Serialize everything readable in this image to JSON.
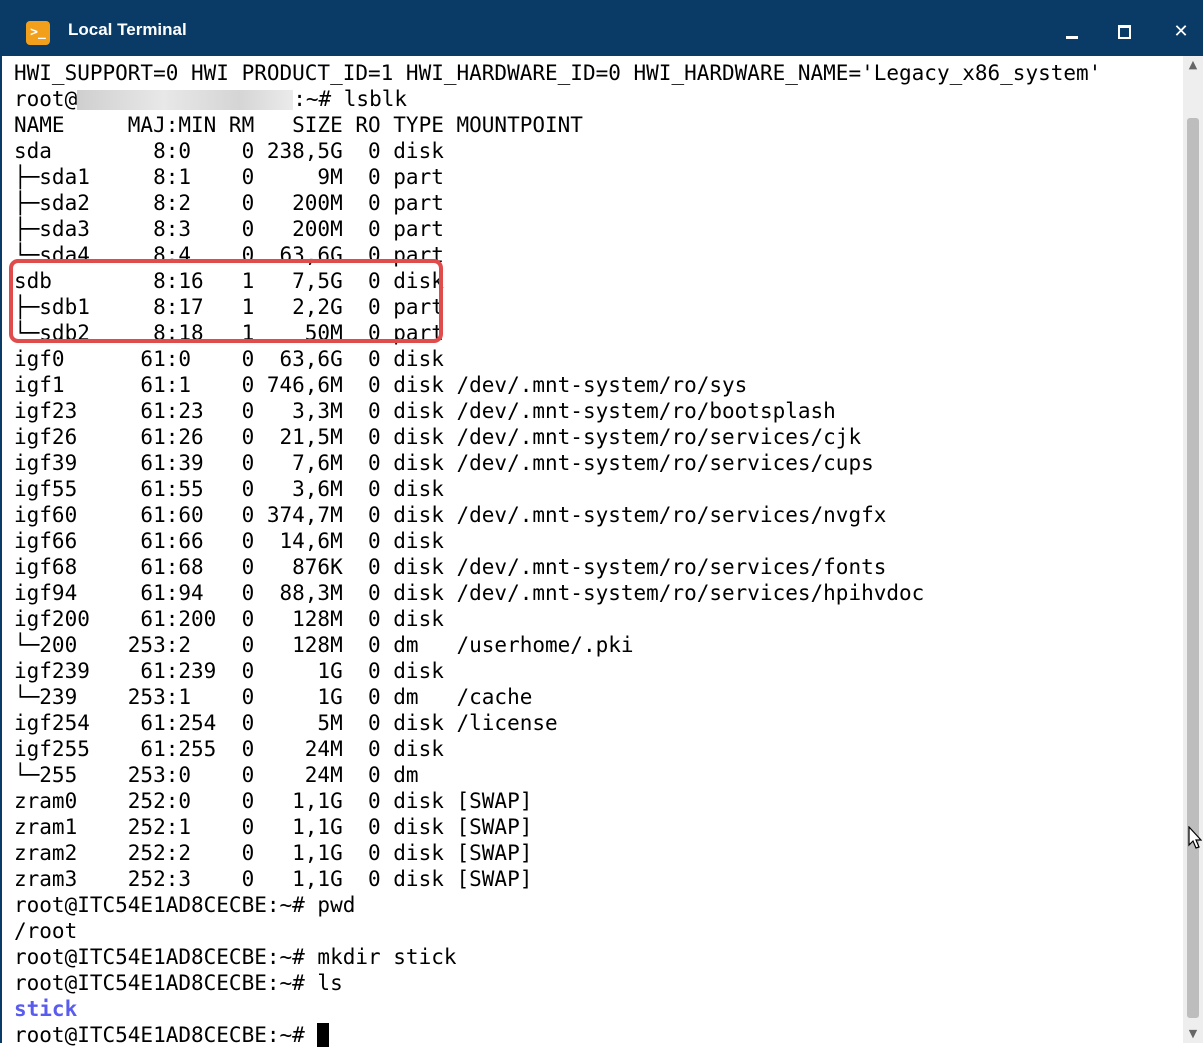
{
  "window": {
    "title": "Local Terminal",
    "icon": "terminal-app-icon",
    "icon_glyph": ">_",
    "controls": {
      "minimize": "minimize-icon",
      "maximize": "maximize-icon",
      "close": "close-icon",
      "close_glyph": "✕"
    }
  },
  "colors": {
    "titlebar": "#0a3b67",
    "highlight_box": "#e04b4b",
    "directory_text": "#5a5cf0"
  },
  "terminal": {
    "lines": [
      "HWI_SUPPORT=0 HWI PRODUCT_ID=1 HWI_HARDWARE_ID=0 HWI_HARDWARE_NAME='Legacy_x86_system'",
      {
        "before": "root@",
        "after": ":~# lsblk"
      },
      "NAME     MAJ:MIN RM   SIZE RO TYPE MOUNTPOINT",
      "sda        8:0    0 238,5G  0 disk",
      "├─sda1     8:1    0     9M  0 part",
      "├─sda2     8:2    0   200M  0 part",
      "├─sda3     8:3    0   200M  0 part",
      "└─sda4     8:4    0  63,6G  0 part",
      "sdb        8:16   1   7,5G  0 disk",
      "├─sdb1     8:17   1   2,2G  0 part",
      "└─sdb2     8:18   1    50M  0 part",
      "igf0      61:0    0  63,6G  0 disk",
      "igf1      61:1    0 746,6M  0 disk /dev/.mnt-system/ro/sys",
      "igf23     61:23   0   3,3M  0 disk /dev/.mnt-system/ro/bootsplash",
      "igf26     61:26   0  21,5M  0 disk /dev/.mnt-system/ro/services/cjk",
      "igf39     61:39   0   7,6M  0 disk /dev/.mnt-system/ro/services/cups",
      "igf55     61:55   0   3,6M  0 disk",
      "igf60     61:60   0 374,7M  0 disk /dev/.mnt-system/ro/services/nvgfx",
      "igf66     61:66   0  14,6M  0 disk",
      "igf68     61:68   0   876K  0 disk /dev/.mnt-system/ro/services/fonts",
      "igf94     61:94   0  88,3M  0 disk /dev/.mnt-system/ro/services/hpihvdoc",
      "igf200    61:200  0   128M  0 disk",
      "└─200    253:2    0   128M  0 dm   /userhome/.pki",
      "igf239    61:239  0     1G  0 disk",
      "└─239    253:1    0     1G  0 dm   /cache",
      "igf254    61:254  0     5M  0 disk /license",
      "igf255    61:255  0    24M  0 disk",
      "└─255    253:0    0    24M  0 dm",
      "zram0    252:0    0   1,1G  0 disk [SWAP]",
      "zram1    252:1    0   1,1G  0 disk [SWAP]",
      "zram2    252:2    0   1,1G  0 disk [SWAP]",
      "zram3    252:3    0   1,1G  0 disk [SWAP]",
      "root@ITC54E1AD8CECBE:~# pwd",
      "/root",
      "root@ITC54E1AD8CECBE:~# mkdir stick",
      "root@ITC54E1AD8CECBE:~# ls",
      {
        "dir": "stick"
      },
      {
        "prompt": "root@ITC54E1AD8CECBE:~# ",
        "cursor": true
      }
    ]
  },
  "scrollbar": {
    "up_glyph": "▲",
    "down_glyph": "▼"
  }
}
